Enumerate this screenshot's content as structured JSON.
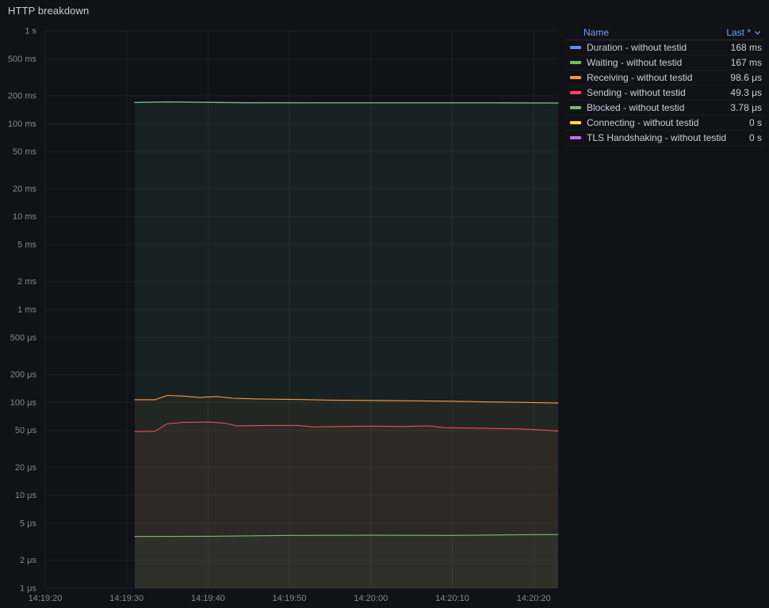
{
  "panel": {
    "title": "HTTP breakdown"
  },
  "colors": {
    "background": "#111217",
    "grid": "rgba(204,204,220,0.07)",
    "axis_text": "rgba(204,204,220,0.62)",
    "text": "#CCCCDC",
    "header_link": "#6E9FFF"
  },
  "legend": {
    "name_header": "Name",
    "last_header": "Last *",
    "rows": [
      {
        "label": "Duration - without testid",
        "value": "168 ms",
        "color": "#5794F2"
      },
      {
        "label": "Waiting - without testid",
        "value": "167 ms",
        "color": "#73BF69"
      },
      {
        "label": "Receiving - without testid",
        "value": "98.6 μs",
        "color": "#FF9830"
      },
      {
        "label": "Sending - without testid",
        "value": "49.3 μs",
        "color": "#F2495C"
      },
      {
        "label": "Blocked - without testid",
        "value": "3.78 μs",
        "color": "#73BF69"
      },
      {
        "label": "Connecting - without testid",
        "value": "0 s",
        "color": "#FADE2A"
      },
      {
        "label": "TLS Handshaking - without testid",
        "value": "0 s",
        "color": "#B877D9"
      }
    ]
  },
  "chart_data": {
    "type": "line",
    "title": "HTTP breakdown",
    "y_scale": "log10",
    "y_unit": "seconds",
    "grid": true,
    "legend_position": "right-top",
    "fill_opacity": 0.05,
    "x_domain_seconds": [
      0,
      63
    ],
    "x_ticks": [
      {
        "t": 0,
        "label": "14:19:20"
      },
      {
        "t": 10,
        "label": "14:19:30"
      },
      {
        "t": 20,
        "label": "14:19:40"
      },
      {
        "t": 30,
        "label": "14:19:50"
      },
      {
        "t": 40,
        "label": "14:20:00"
      },
      {
        "t": 50,
        "label": "14:20:10"
      },
      {
        "t": 60,
        "label": "14:20:20"
      }
    ],
    "y_ticks": [
      {
        "value": 1,
        "label": "1 s"
      },
      {
        "value": 0.5,
        "label": "500 ms"
      },
      {
        "value": 0.2,
        "label": "200 ms"
      },
      {
        "value": 0.1,
        "label": "100 ms"
      },
      {
        "value": 0.05,
        "label": "50 ms"
      },
      {
        "value": 0.02,
        "label": "20 ms"
      },
      {
        "value": 0.01,
        "label": "10 ms"
      },
      {
        "value": 0.005,
        "label": "5 ms"
      },
      {
        "value": 0.002,
        "label": "2 ms"
      },
      {
        "value": 0.001,
        "label": "1 ms"
      },
      {
        "value": 0.0005,
        "label": "500 μs"
      },
      {
        "value": 0.0002,
        "label": "200 μs"
      },
      {
        "value": 0.0001,
        "label": "100 μs"
      },
      {
        "value": 5e-05,
        "label": "50 μs"
      },
      {
        "value": 2e-05,
        "label": "20 μs"
      },
      {
        "value": 1e-05,
        "label": "10 μs"
      },
      {
        "value": 5e-06,
        "label": "5 μs"
      },
      {
        "value": 2e-06,
        "label": "2 μs"
      },
      {
        "value": 1e-06,
        "label": "1 μs"
      }
    ],
    "series": [
      {
        "name": "Duration - without testid",
        "color": "#5794F2",
        "last": "168 ms",
        "points": [
          [
            11,
            0.17
          ],
          [
            15,
            0.1725
          ],
          [
            20,
            0.1705
          ],
          [
            25,
            0.169
          ],
          [
            35,
            0.1685
          ],
          [
            45,
            0.1685
          ],
          [
            55,
            0.1685
          ],
          [
            63,
            0.168
          ]
        ]
      },
      {
        "name": "Waiting - without testid",
        "color": "#73BF69",
        "last": "167 ms",
        "points": [
          [
            11,
            0.169
          ],
          [
            15,
            0.1715
          ],
          [
            20,
            0.1695
          ],
          [
            25,
            0.168
          ],
          [
            35,
            0.1675
          ],
          [
            45,
            0.1675
          ],
          [
            55,
            0.1675
          ],
          [
            63,
            0.167
          ]
        ]
      },
      {
        "name": "Receiving - without testid",
        "color": "#FF9830",
        "last": "98.6 μs",
        "points": [
          [
            11,
            0.000107
          ],
          [
            13.5,
            0.000107
          ],
          [
            15,
            0.000119
          ],
          [
            17,
            0.000117
          ],
          [
            19,
            0.000113
          ],
          [
            21,
            0.000116
          ],
          [
            23,
            0.000111
          ],
          [
            26,
            0.000109
          ],
          [
            30,
            0.000108
          ],
          [
            35,
            0.000106
          ],
          [
            40,
            0.000105
          ],
          [
            45,
            0.000104
          ],
          [
            50,
            0.000103
          ],
          [
            55,
            0.000101
          ],
          [
            59,
            0.0001
          ],
          [
            63,
            9.86e-05
          ]
        ]
      },
      {
        "name": "Sending - without testid",
        "color": "#F2495C",
        "last": "49.3 μs",
        "points": [
          [
            11,
            4.85e-05
          ],
          [
            13.5,
            4.9e-05
          ],
          [
            15,
            5.9e-05
          ],
          [
            17,
            6.1e-05
          ],
          [
            20,
            6.15e-05
          ],
          [
            22,
            6e-05
          ],
          [
            23.5,
            5.6e-05
          ],
          [
            27,
            5.65e-05
          ],
          [
            31,
            5.65e-05
          ],
          [
            33,
            5.45e-05
          ],
          [
            36,
            5.5e-05
          ],
          [
            40,
            5.55e-05
          ],
          [
            44,
            5.5e-05
          ],
          [
            47,
            5.6e-05
          ],
          [
            49,
            5.35e-05
          ],
          [
            52,
            5.3e-05
          ],
          [
            55,
            5.25e-05
          ],
          [
            58,
            5.2e-05
          ],
          [
            60,
            5.1e-05
          ],
          [
            63,
            4.93e-05
          ]
        ]
      },
      {
        "name": "Blocked - without testid",
        "color": "#73BF69",
        "last": "3.78 μs",
        "points": [
          [
            11,
            3.6e-06
          ],
          [
            20,
            3.62e-06
          ],
          [
            30,
            3.7e-06
          ],
          [
            40,
            3.72e-06
          ],
          [
            50,
            3.7e-06
          ],
          [
            57,
            3.75e-06
          ],
          [
            63,
            3.78e-06
          ]
        ]
      },
      {
        "name": "Connecting - without testid",
        "color": "#FADE2A",
        "last": "0 s",
        "points": []
      },
      {
        "name": "TLS Handshaking - without testid",
        "color": "#B877D9",
        "last": "0 s",
        "points": []
      }
    ]
  }
}
